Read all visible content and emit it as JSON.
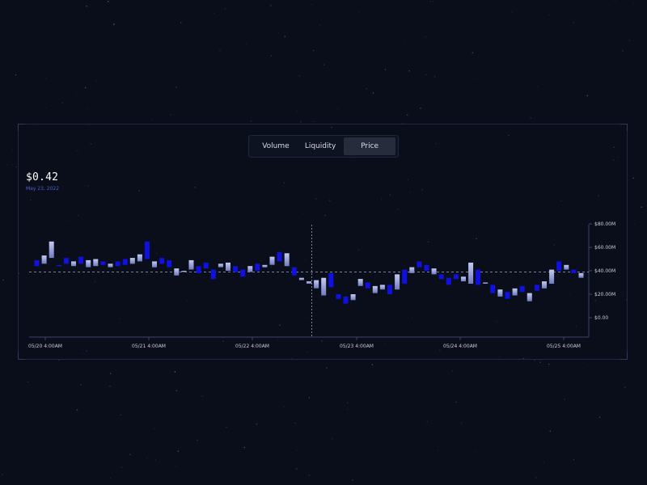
{
  "tabs": [
    {
      "label": "Volume"
    },
    {
      "label": "Liquidity"
    },
    {
      "label": "Price",
      "active": true
    }
  ],
  "header": {
    "price": "$0.42",
    "date": "May 23, 2022"
  },
  "colors": {
    "background": "#0a0e1a",
    "candle_up": "#1010e0",
    "candle_down": "#aab4e6",
    "accent_date": "#4b63c8",
    "active_tab": "#262c3c"
  },
  "chart_data": {
    "type": "candlestick",
    "title": "",
    "xlabel": "",
    "ylabel": "",
    "y_axis_side": "right",
    "ylim": [
      0,
      80
    ],
    "y_ticks": [
      "$80.00M",
      "$60.00M",
      "$40.00M",
      "$20.00M",
      "$0.00"
    ],
    "x_ticks": [
      "05/20 4:00AM",
      "05/21 4:00AM",
      "05/22 4:00AM",
      "05/23 4:00AM",
      "05/24 4:00AM",
      "05/25 4:00AM"
    ],
    "reference_value": 39,
    "crosshair_index": 38,
    "candles": [
      {
        "o": 44,
        "c": 49,
        "up": true
      },
      {
        "o": 46,
        "c": 53,
        "up": false
      },
      {
        "o": 51,
        "c": 65,
        "up": false
      },
      {
        "o": 44,
        "c": 45,
        "up": true
      },
      {
        "o": 46,
        "c": 51,
        "up": true
      },
      {
        "o": 44,
        "c": 48,
        "up": false
      },
      {
        "o": 46,
        "c": 52,
        "up": true
      },
      {
        "o": 43,
        "c": 49,
        "up": false
      },
      {
        "o": 44,
        "c": 50,
        "up": false
      },
      {
        "o": 45,
        "c": 48,
        "up": true
      },
      {
        "o": 43,
        "c": 46,
        "up": false
      },
      {
        "o": 44,
        "c": 48,
        "up": true
      },
      {
        "o": 45,
        "c": 50,
        "up": true
      },
      {
        "o": 46,
        "c": 51,
        "up": false
      },
      {
        "o": 48,
        "c": 54,
        "up": false
      },
      {
        "o": 50,
        "c": 65,
        "up": true
      },
      {
        "o": 43,
        "c": 48,
        "up": false
      },
      {
        "o": 46,
        "c": 51,
        "up": true
      },
      {
        "o": 43,
        "c": 49,
        "up": true
      },
      {
        "o": 36,
        "c": 42,
        "up": false
      },
      {
        "o": 39,
        "c": 40,
        "up": false
      },
      {
        "o": 41,
        "c": 49,
        "up": false
      },
      {
        "o": 38,
        "c": 44,
        "up": true
      },
      {
        "o": 42,
        "c": 47,
        "up": true
      },
      {
        "o": 33,
        "c": 41,
        "up": true
      },
      {
        "o": 43,
        "c": 46,
        "up": false
      },
      {
        "o": 40,
        "c": 47,
        "up": false
      },
      {
        "o": 39,
        "c": 44,
        "up": true
      },
      {
        "o": 35,
        "c": 41,
        "up": true
      },
      {
        "o": 39,
        "c": 44,
        "up": false
      },
      {
        "o": 40,
        "c": 46,
        "up": true
      },
      {
        "o": 43,
        "c": 45,
        "up": false
      },
      {
        "o": 45,
        "c": 52,
        "up": false
      },
      {
        "o": 48,
        "c": 56,
        "up": true
      },
      {
        "o": 44,
        "c": 55,
        "up": false
      },
      {
        "o": 36,
        "c": 43,
        "up": true
      },
      {
        "o": 32,
        "c": 34,
        "up": false
      },
      {
        "o": 29,
        "c": 31,
        "up": false
      },
      {
        "o": 25,
        "c": 32,
        "up": false
      },
      {
        "o": 19,
        "c": 34,
        "up": false
      },
      {
        "o": 26,
        "c": 38,
        "up": true
      },
      {
        "o": 16,
        "c": 20,
        "up": true
      },
      {
        "o": 12,
        "c": 18,
        "up": true
      },
      {
        "o": 15,
        "c": 20,
        "up": false
      },
      {
        "o": 27,
        "c": 33,
        "up": false
      },
      {
        "o": 25,
        "c": 30,
        "up": true
      },
      {
        "o": 21,
        "c": 27,
        "up": false
      },
      {
        "o": 24,
        "c": 28,
        "up": false
      },
      {
        "o": 20,
        "c": 28,
        "up": true
      },
      {
        "o": 24,
        "c": 37,
        "up": false
      },
      {
        "o": 29,
        "c": 41,
        "up": true
      },
      {
        "o": 38,
        "c": 43,
        "up": false
      },
      {
        "o": 43,
        "c": 48,
        "up": true
      },
      {
        "o": 40,
        "c": 45,
        "up": true
      },
      {
        "o": 37,
        "c": 42,
        "up": false
      },
      {
        "o": 33,
        "c": 37,
        "up": true
      },
      {
        "o": 28,
        "c": 34,
        "up": true
      },
      {
        "o": 33,
        "c": 37,
        "up": true
      },
      {
        "o": 31,
        "c": 35,
        "up": false
      },
      {
        "o": 29,
        "c": 47,
        "up": false
      },
      {
        "o": 28,
        "c": 41,
        "up": true
      },
      {
        "o": 29,
        "c": 30,
        "up": false
      },
      {
        "o": 21,
        "c": 28,
        "up": true
      },
      {
        "o": 18,
        "c": 24,
        "up": false
      },
      {
        "o": 16,
        "c": 22,
        "up": true
      },
      {
        "o": 19,
        "c": 25,
        "up": false
      },
      {
        "o": 22,
        "c": 27,
        "up": true
      },
      {
        "o": 14,
        "c": 21,
        "up": false
      },
      {
        "o": 23,
        "c": 28,
        "up": true
      },
      {
        "o": 25,
        "c": 31,
        "up": false
      },
      {
        "o": 29,
        "c": 41,
        "up": false
      },
      {
        "o": 40,
        "c": 48,
        "up": true
      },
      {
        "o": 41,
        "c": 45,
        "up": false
      },
      {
        "o": 38,
        "c": 41,
        "up": true
      },
      {
        "o": 34,
        "c": 38,
        "up": false
      }
    ]
  }
}
